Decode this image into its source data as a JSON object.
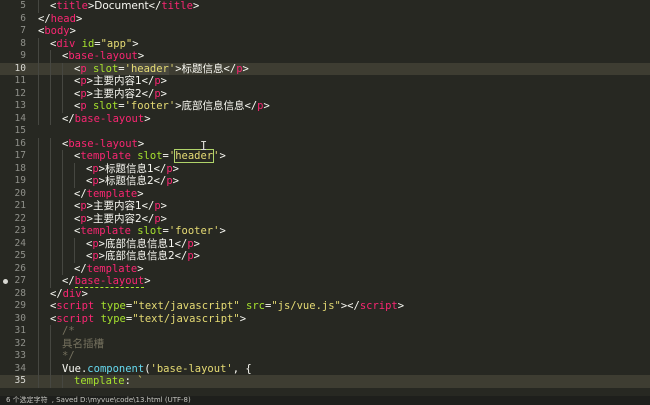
{
  "editor": {
    "lines": [
      {
        "n": "5",
        "indent": 1,
        "tokens": [
          [
            "t",
            "<"
          ],
          [
            "tag",
            "title"
          ],
          [
            "t",
            ">"
          ],
          [
            "cjk",
            "Document"
          ],
          [
            "t",
            "</"
          ],
          [
            "tag",
            "title"
          ],
          [
            "t",
            ">"
          ]
        ]
      },
      {
        "n": "6",
        "indent": 0,
        "tokens": [
          [
            "t",
            "</"
          ],
          [
            "tag",
            "head"
          ],
          [
            "t",
            ">"
          ]
        ]
      },
      {
        "n": "7",
        "indent": 0,
        "tokens": [
          [
            "t",
            "<"
          ],
          [
            "tag",
            "body"
          ],
          [
            "t",
            ">"
          ]
        ]
      },
      {
        "n": "8",
        "indent": 1,
        "tokens": [
          [
            "t",
            "<"
          ],
          [
            "tag",
            "div"
          ],
          [
            "t",
            " "
          ],
          [
            "attr",
            "id"
          ],
          [
            "t",
            "="
          ],
          [
            "str",
            "\"app\""
          ],
          [
            "t",
            ">"
          ]
        ]
      },
      {
        "n": "9",
        "indent": 2,
        "tokens": [
          [
            "t",
            "<"
          ],
          [
            "tag",
            "base-layout"
          ],
          [
            "t",
            ">"
          ]
        ]
      },
      {
        "n": "10",
        "indent": 3,
        "active": true,
        "tokens": [
          [
            "t",
            "<"
          ],
          [
            "tag",
            "p"
          ],
          [
            "t",
            " "
          ],
          [
            "attr",
            "slot"
          ],
          [
            "t",
            "="
          ],
          [
            "str",
            "'"
          ],
          [
            "str_hl",
            "header"
          ],
          [
            "str",
            "'"
          ],
          [
            "t",
            ">"
          ],
          [
            "cjk",
            "标题信息"
          ],
          [
            "t",
            "</"
          ],
          [
            "tag",
            "p"
          ],
          [
            "t",
            ">"
          ]
        ]
      },
      {
        "n": "11",
        "indent": 3,
        "tokens": [
          [
            "t",
            "<"
          ],
          [
            "tag",
            "p"
          ],
          [
            "t",
            ">"
          ],
          [
            "cjk",
            "主要内容1"
          ],
          [
            "t",
            "</"
          ],
          [
            "tag",
            "p"
          ],
          [
            "t",
            ">"
          ]
        ]
      },
      {
        "n": "12",
        "indent": 3,
        "tokens": [
          [
            "t",
            "<"
          ],
          [
            "tag",
            "p"
          ],
          [
            "t",
            ">"
          ],
          [
            "cjk",
            "主要内容2"
          ],
          [
            "t",
            "</"
          ],
          [
            "tag",
            "p"
          ],
          [
            "t",
            ">"
          ]
        ]
      },
      {
        "n": "13",
        "indent": 3,
        "tokens": [
          [
            "t",
            "<"
          ],
          [
            "tag",
            "p"
          ],
          [
            "t",
            " "
          ],
          [
            "attr",
            "slot"
          ],
          [
            "t",
            "="
          ],
          [
            "str",
            "'footer'"
          ],
          [
            "t",
            ">"
          ],
          [
            "cjk",
            "底部信息信息"
          ],
          [
            "t",
            "</"
          ],
          [
            "tag",
            "p"
          ],
          [
            "t",
            ">"
          ]
        ]
      },
      {
        "n": "14",
        "indent": 2,
        "tokens": [
          [
            "t",
            "</"
          ],
          [
            "tag",
            "base-layout"
          ],
          [
            "t",
            ">"
          ]
        ]
      },
      {
        "n": "15",
        "indent": 0,
        "tokens": []
      },
      {
        "n": "16",
        "indent": 2,
        "tokens": [
          [
            "t",
            "<"
          ],
          [
            "tag",
            "base-layout"
          ],
          [
            "t",
            ">"
          ]
        ]
      },
      {
        "n": "17",
        "indent": 3,
        "tokens": [
          [
            "t",
            "<"
          ],
          [
            "tag",
            "template"
          ],
          [
            "t",
            " "
          ],
          [
            "attr",
            "slot"
          ],
          [
            "t",
            "="
          ],
          [
            "str",
            "'"
          ],
          [
            "str_box",
            "header"
          ],
          [
            "str",
            "'"
          ],
          [
            "t",
            ">"
          ]
        ]
      },
      {
        "n": "18",
        "indent": 4,
        "tokens": [
          [
            "t",
            "<"
          ],
          [
            "tag",
            "p"
          ],
          [
            "t",
            ">"
          ],
          [
            "cjk",
            "标题信息1"
          ],
          [
            "t",
            "</"
          ],
          [
            "tag",
            "p"
          ],
          [
            "t",
            ">"
          ]
        ]
      },
      {
        "n": "19",
        "indent": 4,
        "tokens": [
          [
            "t",
            "<"
          ],
          [
            "tag",
            "p"
          ],
          [
            "t",
            ">"
          ],
          [
            "cjk",
            "标题信息2"
          ],
          [
            "t",
            "</"
          ],
          [
            "tag",
            "p"
          ],
          [
            "t",
            ">"
          ]
        ]
      },
      {
        "n": "20",
        "indent": 3,
        "tokens": [
          [
            "t",
            "</"
          ],
          [
            "tag",
            "template"
          ],
          [
            "t",
            ">"
          ]
        ]
      },
      {
        "n": "21",
        "indent": 3,
        "tokens": [
          [
            "t",
            "<"
          ],
          [
            "tag",
            "p"
          ],
          [
            "t",
            ">"
          ],
          [
            "cjk",
            "主要内容1"
          ],
          [
            "t",
            "</"
          ],
          [
            "tag",
            "p"
          ],
          [
            "t",
            ">"
          ]
        ]
      },
      {
        "n": "22",
        "indent": 3,
        "tokens": [
          [
            "t",
            "<"
          ],
          [
            "tag",
            "p"
          ],
          [
            "t",
            ">"
          ],
          [
            "cjk",
            "主要内容2"
          ],
          [
            "t",
            "</"
          ],
          [
            "tag",
            "p"
          ],
          [
            "t",
            ">"
          ]
        ]
      },
      {
        "n": "23",
        "indent": 3,
        "tokens": [
          [
            "t",
            "<"
          ],
          [
            "tag",
            "template"
          ],
          [
            "t",
            " "
          ],
          [
            "attr",
            "slot"
          ],
          [
            "t",
            "="
          ],
          [
            "str",
            "'footer'"
          ],
          [
            "t",
            ">"
          ]
        ]
      },
      {
        "n": "24",
        "indent": 4,
        "tokens": [
          [
            "t",
            "<"
          ],
          [
            "tag",
            "p"
          ],
          [
            "t",
            ">"
          ],
          [
            "cjk",
            "底部信息信息1"
          ],
          [
            "t",
            "</"
          ],
          [
            "tag",
            "p"
          ],
          [
            "t",
            ">"
          ]
        ]
      },
      {
        "n": "25",
        "indent": 4,
        "tokens": [
          [
            "t",
            "<"
          ],
          [
            "tag",
            "p"
          ],
          [
            "t",
            ">"
          ],
          [
            "cjk",
            "底部信息信息2"
          ],
          [
            "t",
            "</"
          ],
          [
            "tag",
            "p"
          ],
          [
            "t",
            ">"
          ]
        ]
      },
      {
        "n": "26",
        "indent": 3,
        "tokens": [
          [
            "t",
            "</"
          ],
          [
            "tag",
            "template"
          ],
          [
            "t",
            ">"
          ]
        ]
      },
      {
        "n": "27",
        "indent": 2,
        "dot": true,
        "tokens": [
          [
            "t",
            "</"
          ],
          [
            "tag_ul",
            "base-layout"
          ],
          [
            "t",
            ">"
          ]
        ]
      },
      {
        "n": "28",
        "indent": 1,
        "tokens": [
          [
            "t",
            "</"
          ],
          [
            "tag",
            "div"
          ],
          [
            "t",
            ">"
          ]
        ]
      },
      {
        "n": "29",
        "indent": 1,
        "tokens": [
          [
            "t",
            "<"
          ],
          [
            "tag",
            "script"
          ],
          [
            "t",
            " "
          ],
          [
            "attr",
            "type"
          ],
          [
            "t",
            "="
          ],
          [
            "str",
            "\"text/javascript\""
          ],
          [
            "t",
            " "
          ],
          [
            "attr",
            "src"
          ],
          [
            "t",
            "="
          ],
          [
            "str",
            "\"js/vue.js\""
          ],
          [
            "t",
            "></"
          ],
          [
            "tag",
            "script"
          ],
          [
            "t",
            ">"
          ]
        ]
      },
      {
        "n": "30",
        "indent": 1,
        "tokens": [
          [
            "t",
            "<"
          ],
          [
            "tag",
            "script"
          ],
          [
            "t",
            " "
          ],
          [
            "attr",
            "type"
          ],
          [
            "t",
            "="
          ],
          [
            "str",
            "\"text/javascript\""
          ],
          [
            "t",
            ">"
          ]
        ]
      },
      {
        "n": "31",
        "indent": 2,
        "tokens": [
          [
            "comment",
            "/*"
          ]
        ]
      },
      {
        "n": "32",
        "indent": 2,
        "tokens": [
          [
            "comment_cjk",
            "具名插槽"
          ]
        ]
      },
      {
        "n": "33",
        "indent": 2,
        "tokens": [
          [
            "comment",
            "*/"
          ]
        ]
      },
      {
        "n": "34",
        "indent": 2,
        "tokens": [
          [
            "t",
            "Vue."
          ],
          [
            "fn",
            "component"
          ],
          [
            "t",
            "("
          ],
          [
            "str",
            "'base-layout'"
          ],
          [
            "t",
            ", {"
          ]
        ]
      },
      {
        "n": "35",
        "indent": 3,
        "active": true,
        "tokens": [
          [
            "attr",
            "template"
          ],
          [
            "t",
            ": "
          ],
          [
            "str",
            "`"
          ]
        ]
      }
    ]
  },
  "statusbar": {
    "selection": "6 个选定字符",
    "saved": ", Saved D:\\myvue\\code\\13.html (UTF-8)"
  },
  "colors": {
    "background": "#272822",
    "tag": "#f92672",
    "attr": "#a6e22e",
    "string": "#e6db74",
    "comment": "#75715e"
  }
}
